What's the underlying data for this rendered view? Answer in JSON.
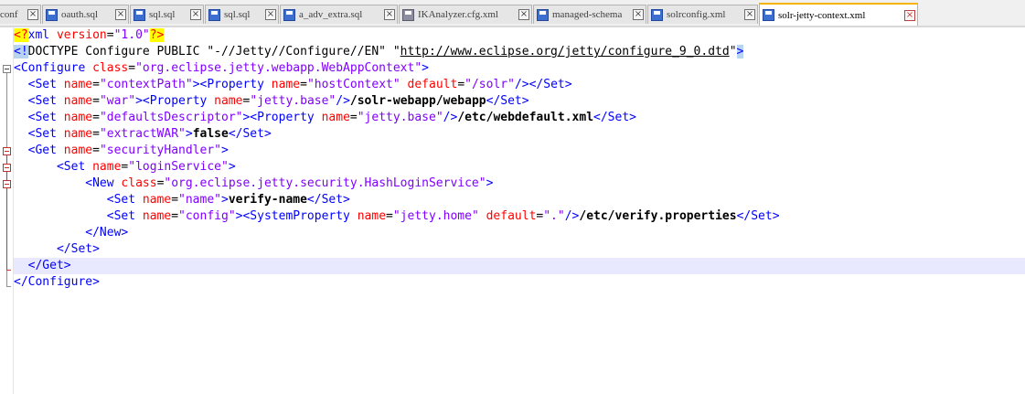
{
  "tabs": [
    {
      "label": "conf",
      "icon": "none",
      "active": false
    },
    {
      "label": "oauth.sql",
      "icon": "saved-file-icon",
      "active": false
    },
    {
      "label": "sql.sql",
      "icon": "saved-file-icon",
      "active": false
    },
    {
      "label": "sql.sql",
      "icon": "saved-file-icon",
      "active": false
    },
    {
      "label": "a_adv_extra.sql",
      "icon": "saved-file-icon",
      "active": false
    },
    {
      "label": "IKAnalyzer.cfg.xml",
      "icon": "unsaved-file-icon",
      "active": false
    },
    {
      "label": "managed-schema",
      "icon": "saved-file-icon",
      "active": false
    },
    {
      "label": "solrconfig.xml",
      "icon": "saved-file-icon",
      "active": false
    },
    {
      "label": "solr-jetty-context.xml",
      "icon": "saved-file-icon",
      "active": true
    }
  ],
  "tab_close_glyph": "×",
  "code": {
    "l1": {
      "p1": "<?",
      "p2": "xml",
      "p3": " version",
      "p4": "=",
      "p5": "\"1.0\"",
      "p6": "?>"
    },
    "l2": {
      "p1": "<!",
      "p2": "DOCTYPE Configure PUBLIC \"-//Jetty//Configure//EN\" \"",
      "p3": "http://www.eclipse.org/jetty/configure_9_0.dtd",
      "p4": "\"",
      "p5": ">"
    },
    "l3": {
      "indent": "",
      "p1": "<Configure",
      "p2": " class",
      "p3": "=",
      "p4": "\"org.eclipse.jetty.webapp.WebAppContext\"",
      "p5": ">"
    },
    "l4": {
      "indent": "  ",
      "p1": "<Set",
      "p2": " name",
      "p3": "=",
      "p4": "\"contextPath\"",
      "p5": "><Property",
      "p6": " name",
      "p7": "=",
      "p8": "\"hostContext\"",
      "p9": " default",
      "p10": "=",
      "p11": "\"/solr\"",
      "p12": "/></Set>"
    },
    "l5": {
      "indent": "  ",
      "p1": "<Set",
      "p2": " name",
      "p3": "=",
      "p4": "\"war\"",
      "p5": "><Property",
      "p6": " name",
      "p7": "=",
      "p8": "\"jetty.base\"",
      "p9": "/>",
      "p10": "/solr-webapp/webapp",
      "p11": "</Set>"
    },
    "l6": {
      "indent": "  ",
      "p1": "<Set",
      "p2": " name",
      "p3": "=",
      "p4": "\"defaultsDescriptor\"",
      "p5": "><Property",
      "p6": " name",
      "p7": "=",
      "p8": "\"jetty.base\"",
      "p9": "/>",
      "p10": "/etc/webdefault.xml",
      "p11": "</Set>"
    },
    "l7": {
      "indent": "  ",
      "p1": "<Set",
      "p2": " name",
      "p3": "=",
      "p4": "\"extractWAR\"",
      "p5": ">",
      "p6": "false",
      "p7": "</Set>"
    },
    "l8": {
      "indent": "  ",
      "p1": "<Get",
      "p2": " name",
      "p3": "=",
      "p4": "\"securityHandler\"",
      "p5": ">"
    },
    "l9": {
      "indent": "      ",
      "p1": "<Set",
      "p2": " name",
      "p3": "=",
      "p4": "\"loginService\"",
      "p5": ">"
    },
    "l10": {
      "indent": "          ",
      "p1": "<New",
      "p2": " class",
      "p3": "=",
      "p4": "\"org.eclipse.jetty.security.HashLoginService\"",
      "p5": ">"
    },
    "l11": {
      "indent": "             ",
      "p1": "<Set",
      "p2": " name",
      "p3": "=",
      "p4": "\"name\"",
      "p5": ">",
      "p6": "verify-name",
      "p7": "</Set>"
    },
    "l12": {
      "indent": "             ",
      "p1": "<Set",
      "p2": " name",
      "p3": "=",
      "p4": "\"config\"",
      "p5": "><SystemProperty",
      "p6": " name",
      "p7": "=",
      "p8": "\"jetty.home\"",
      "p9": " default",
      "p10": "=",
      "p11": "\".\"",
      "p12": "/>",
      "p13": "/etc/verify.properties",
      "p14": "</Set>"
    },
    "l13": {
      "indent": "          ",
      "p1": "</New>"
    },
    "l14": {
      "indent": "      ",
      "p1": "</Set>"
    },
    "l15": {
      "indent": "  ",
      "p1": "</Get>"
    },
    "l16": {
      "indent": "",
      "p1": "</Configure>"
    }
  }
}
